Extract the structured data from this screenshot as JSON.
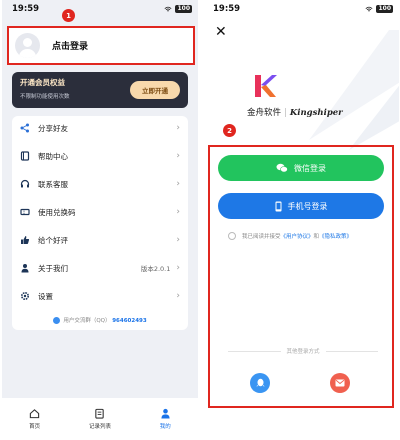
{
  "left": {
    "status": {
      "time": "19:59",
      "battery": "100"
    },
    "annotation": "1",
    "user": {
      "login_text": "点击登录"
    },
    "vip": {
      "title": "开通会员权益",
      "subtitle": "不限制功能使用次数",
      "button": "立即开通"
    },
    "menu": [
      {
        "label": "分享好友",
        "icon": "share-icon"
      },
      {
        "label": "帮助中心",
        "icon": "book-icon"
      },
      {
        "label": "联系客服",
        "icon": "headset-icon"
      },
      {
        "label": "使用兑换码",
        "icon": "ticket-icon"
      },
      {
        "label": "给个好评",
        "icon": "thumbs-up-icon"
      },
      {
        "label": "关于我们",
        "icon": "person-icon",
        "value": "版本2.0.1"
      },
      {
        "label": "设置",
        "icon": "gear-icon"
      }
    ],
    "qq_group": {
      "label": "用户交流群（QQ）",
      "number": "964602493"
    },
    "tabs": [
      {
        "label": "首页",
        "icon": "home-icon"
      },
      {
        "label": "记录列表",
        "icon": "list-icon"
      },
      {
        "label": "我的",
        "icon": "person-icon"
      }
    ],
    "accent_color": "#1a73e8"
  },
  "right": {
    "status": {
      "time": "19:59",
      "battery": "100"
    },
    "annotation": "2",
    "brand": {
      "cn": "金舟软件",
      "en": "Kingshiper"
    },
    "wechat_button": "微信登录",
    "phone_button": "手机号登录",
    "agreement": {
      "prefix": "我已阅读并接受",
      "user_agreement": "《用户协议》",
      "and": "和",
      "privacy": "《隐私政策》"
    },
    "other_methods": "其他登录方式",
    "colors": {
      "wechat": "#22c45e",
      "phone": "#1e78e6",
      "highlight": "#e0261f"
    }
  }
}
